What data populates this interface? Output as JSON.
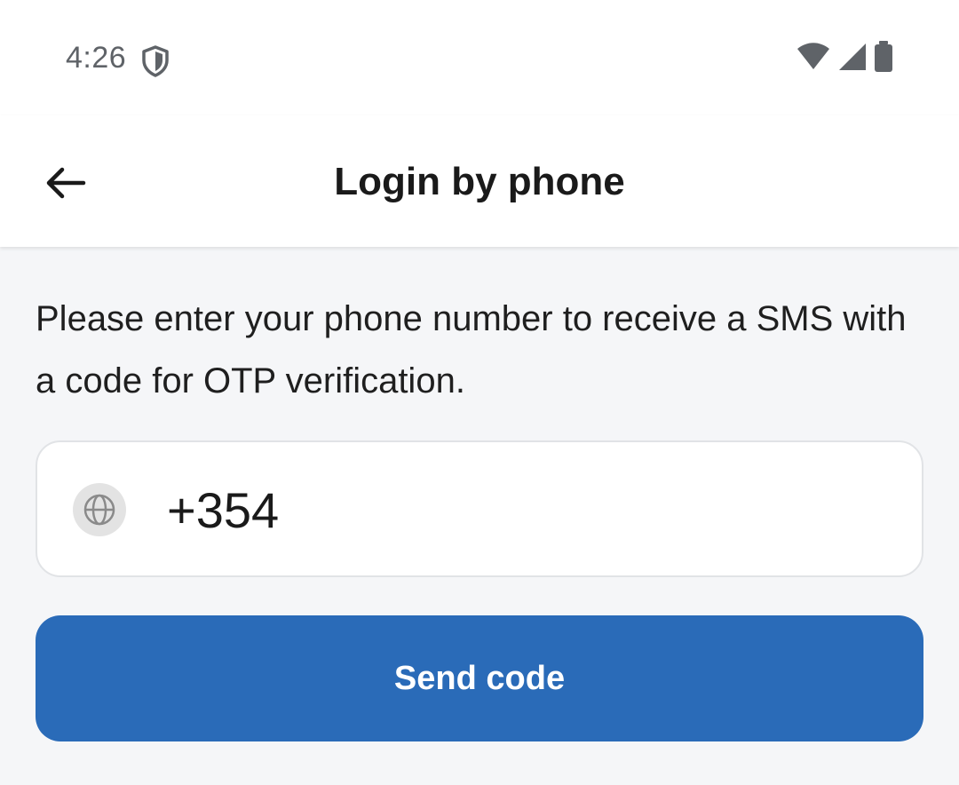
{
  "status_bar": {
    "time": "4:26",
    "icons": [
      "shield-icon",
      "wifi-icon",
      "signal-icon",
      "battery-icon"
    ]
  },
  "app_bar": {
    "back_icon": "arrow-left-icon",
    "title": "Login by phone"
  },
  "main": {
    "description": "Please enter your phone number to receive a SMS with a code for OTP verification.",
    "phone_field": {
      "country_icon": "globe-icon",
      "value": "+354"
    },
    "send_button_label": "Send code"
  },
  "colors": {
    "primary": "#2a6bb8",
    "background": "#f5f6f8",
    "surface": "#ffffff",
    "status_icon": "#5f6368"
  }
}
